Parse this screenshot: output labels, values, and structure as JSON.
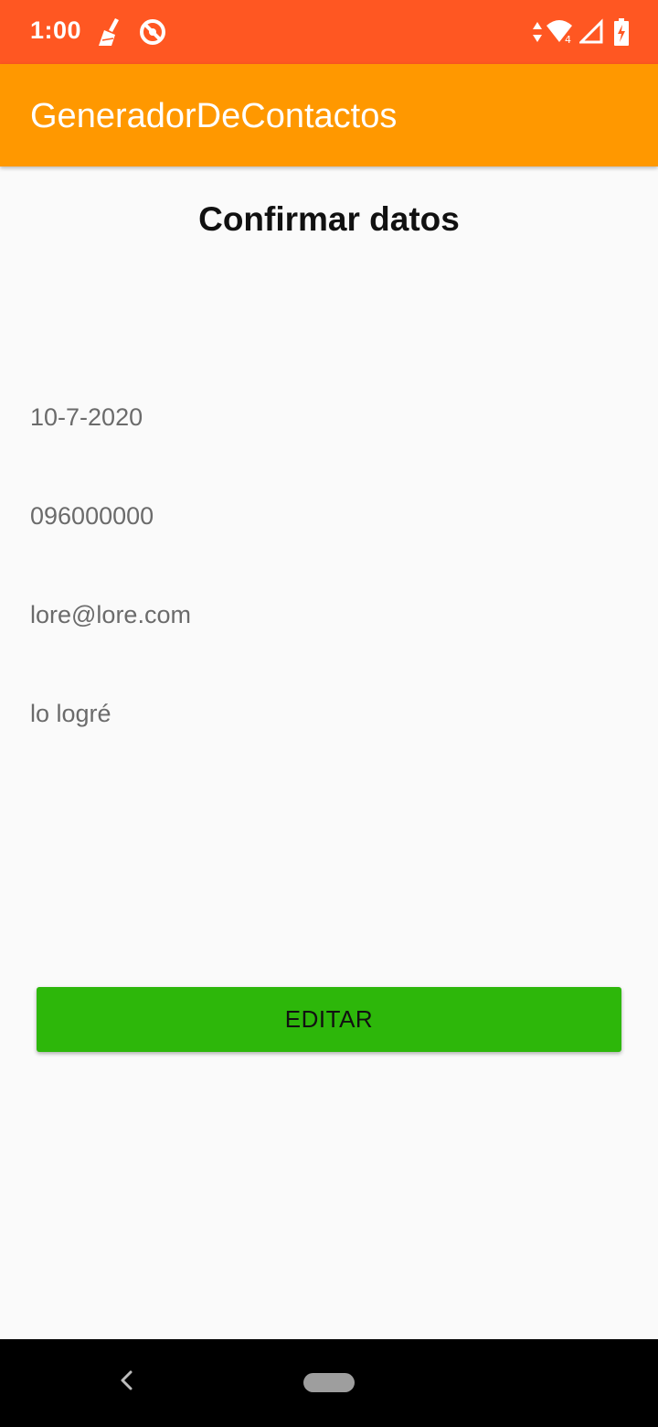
{
  "status_bar": {
    "time": "1:00",
    "icons": [
      "broom-icon",
      "blocked-circle-icon",
      "data-arrows-icon",
      "wifi-icon",
      "cell-signal-icon",
      "battery-charging-icon"
    ],
    "wifi_badge": "4",
    "color": "#ff5722"
  },
  "app_bar": {
    "title": "GeneradorDeContactos",
    "color": "#ff9800"
  },
  "main": {
    "heading": "Confirmar datos",
    "fields": [
      "10-7-2020",
      "096000000",
      "lore@lore.com",
      "lo logré"
    ],
    "edit_button_label": "EDITAR",
    "edit_button_color": "#2db70a"
  },
  "nav_bar": {
    "icons": [
      "back-icon",
      "home-pill-icon"
    ]
  }
}
